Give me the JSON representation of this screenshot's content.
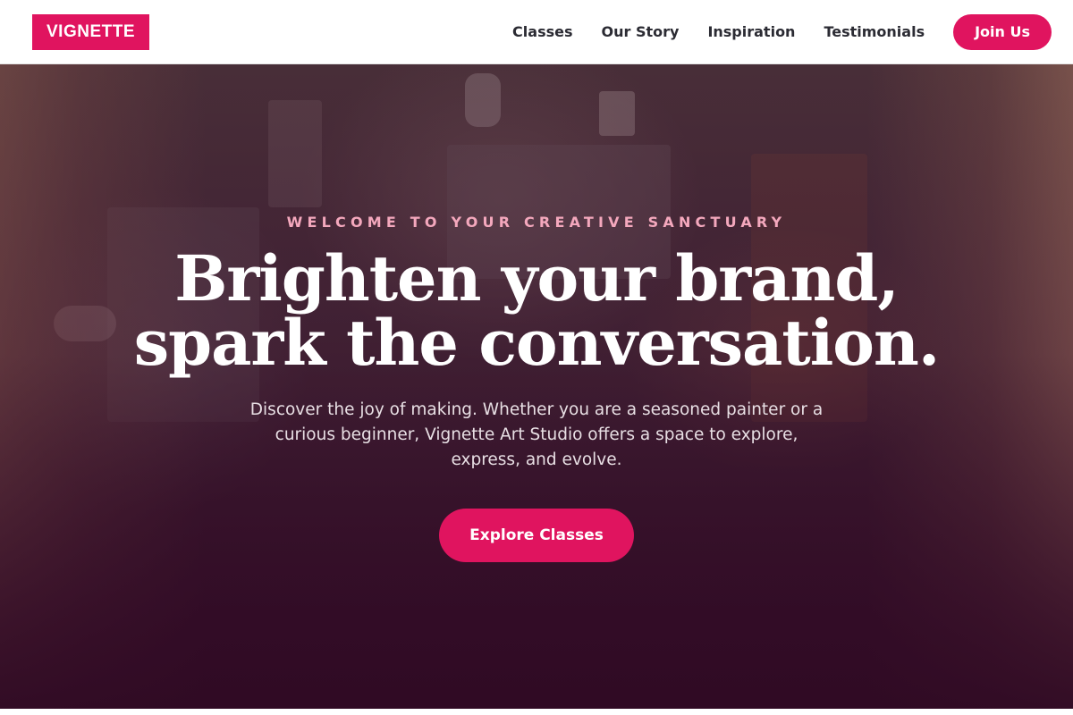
{
  "brand": {
    "logo_text": "VIGNETTE",
    "accent_color": "#e0145f"
  },
  "nav": {
    "items": [
      {
        "label": "Classes"
      },
      {
        "label": "Our Story"
      },
      {
        "label": "Inspiration"
      },
      {
        "label": "Testimonials"
      }
    ],
    "join_label": "Join Us"
  },
  "hero": {
    "eyebrow": "WELCOME TO YOUR CREATIVE SANCTUARY",
    "headline_line1": "Brighten your brand,",
    "headline_line2": "spark the conversation.",
    "lede": "Discover the joy of making. Whether you are a seasoned painter or a curious beginner, Vignette Art Studio offers a space to explore, express, and evolve.",
    "cta_label": "Explore Classes",
    "background": "art studio interior photo with curtains, dark magenta overlay"
  }
}
